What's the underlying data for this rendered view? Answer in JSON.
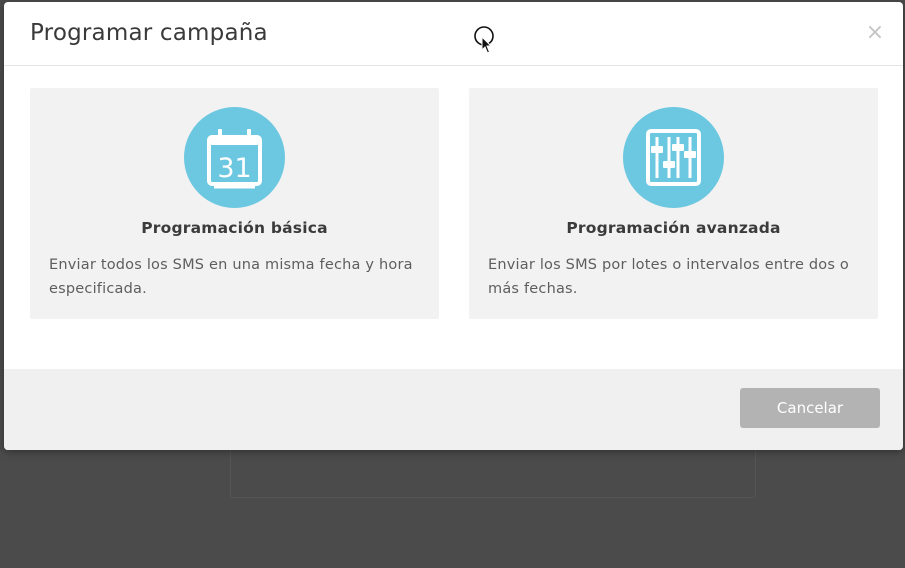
{
  "modal": {
    "title": "Programar campaña",
    "close_label": "×"
  },
  "options": [
    {
      "icon": "calendar-icon",
      "calendar_day": "31",
      "title": "Programación básica",
      "description": "Enviar todos los SMS en una misma fecha y hora especificada."
    },
    {
      "icon": "sliders-icon",
      "title": "Programación avanzada",
      "description": "Enviar los SMS por lotes o intervalos entre dos o más fechas."
    }
  ],
  "footer": {
    "cancel_label": "Cancelar"
  },
  "colors": {
    "icon_circle": "#6cc7e0",
    "card_background": "#f2f2f2",
    "cancel_button": "#b3b3b3"
  }
}
